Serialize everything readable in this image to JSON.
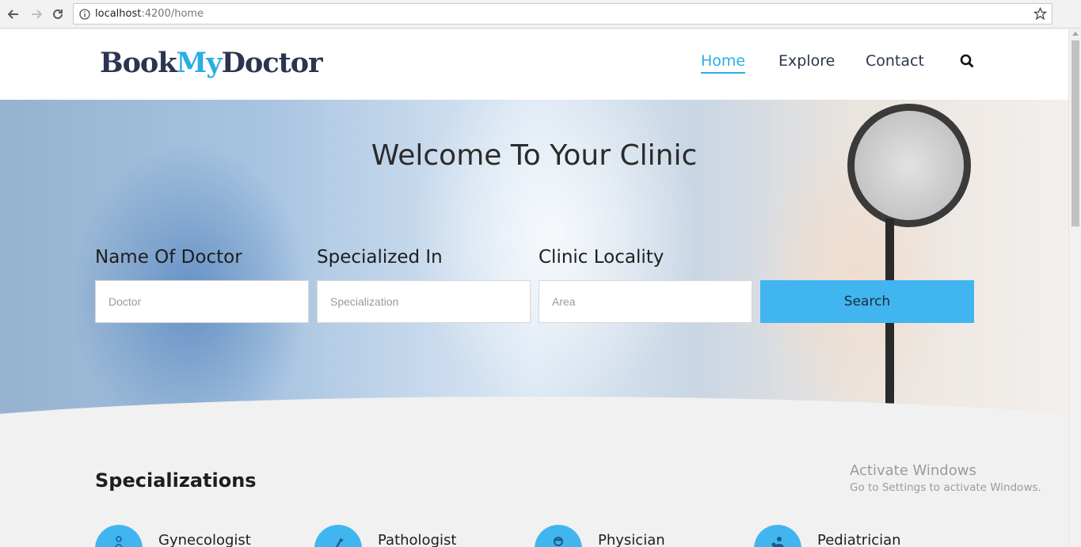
{
  "browser": {
    "url_host": "localhost",
    "url_path": ":4200/home"
  },
  "site": {
    "logo_part1": "Book",
    "logo_part2": "My",
    "logo_part3": "Doctor",
    "nav": [
      {
        "label": "Home",
        "active": true
      },
      {
        "label": "Explore",
        "active": false
      },
      {
        "label": "Contact",
        "active": false
      }
    ]
  },
  "hero": {
    "title": "Welcome To Your Clinic",
    "fields": [
      {
        "label": "Name Of Doctor",
        "placeholder": "Doctor"
      },
      {
        "label": "Specialized In",
        "placeholder": "Specialization"
      },
      {
        "label": "Clinic Locality",
        "placeholder": "Area"
      }
    ],
    "search_label": "Search"
  },
  "specializations": {
    "title": "Specializations",
    "items": [
      {
        "label": "Gynecologist",
        "icon": "gynecologist-icon"
      },
      {
        "label": "Pathologist",
        "icon": "pathologist-icon"
      },
      {
        "label": "Physician",
        "icon": "physician-icon"
      },
      {
        "label": "Pediatrician",
        "icon": "pediatrician-icon"
      }
    ]
  },
  "watermark": {
    "line1": "Activate Windows",
    "line2": "Go to Settings to activate Windows."
  },
  "colors": {
    "accent": "#29aee6",
    "button": "#41b5ef",
    "navy": "#2b3450"
  }
}
